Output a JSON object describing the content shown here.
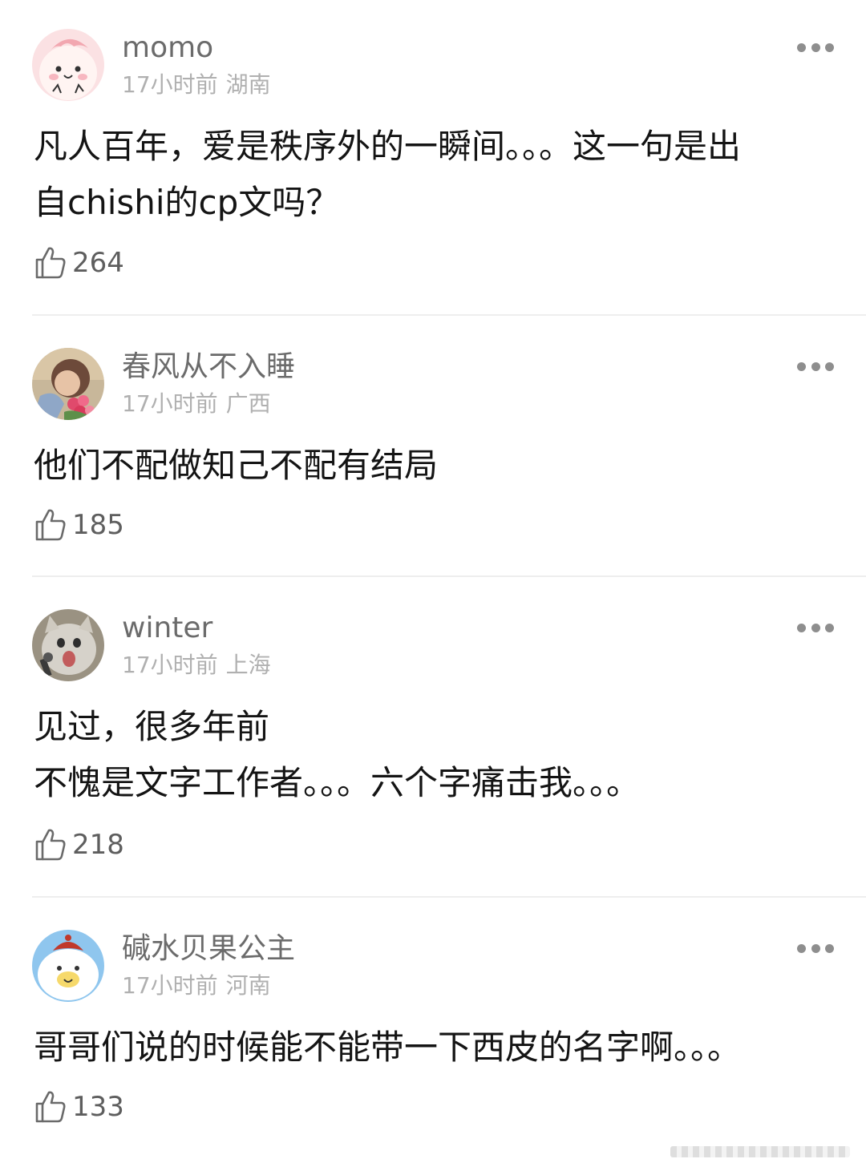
{
  "comments": [
    {
      "username": "momo",
      "time": "17小时前",
      "location": "湖南",
      "lines": [
        "凡人百年，爱是秩序外的一瞬间。。。这一句是出",
        "自chishi的cp文吗？"
      ],
      "likes": "264",
      "avatar_icon": "pink-bear-avatar"
    },
    {
      "username": "春风从不入睡",
      "time": "17小时前",
      "location": "广西",
      "lines": [
        "他们不配做知己不配有结局"
      ],
      "likes": "185",
      "avatar_icon": "person-with-flowers-avatar"
    },
    {
      "username": "winter",
      "time": "17小时前",
      "location": "上海",
      "lines": [
        "见过，很多年前",
        "不愧是文字工作者。。。六个字痛击我。。。"
      ],
      "likes": "218",
      "avatar_icon": "cat-with-microphone-avatar"
    },
    {
      "username": "碱水贝果公主",
      "time": "17小时前",
      "location": "河南",
      "lines": [
        "哥哥们说的时候能不能带一下西皮的名字啊。。。"
      ],
      "likes": "133",
      "avatar_icon": "bear-with-hat-avatar"
    }
  ],
  "icons": {
    "like": "thumbs-up-icon",
    "more": "more-dots-icon"
  },
  "colors": {
    "username": "#6b6b6b",
    "meta": "#b0b0b0",
    "body_text": "#141414",
    "like_count": "#5e5e5e",
    "divider": "#eeeeee"
  }
}
